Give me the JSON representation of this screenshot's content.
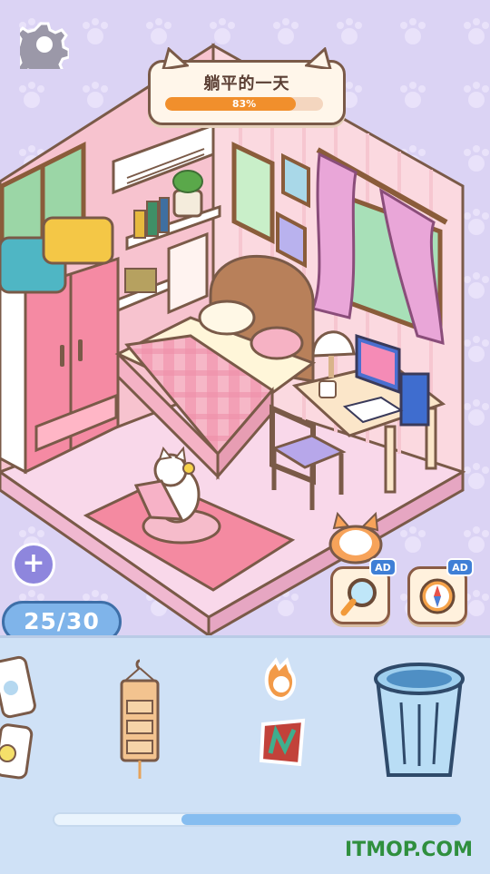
{
  "level": {
    "title": "躺平的一天",
    "progress_percent": 83,
    "progress_label": "83%"
  },
  "inventory": {
    "count_label": "25/30",
    "add_icon": "plus-icon",
    "items": [
      "sticker-cards",
      "hanging-organizer",
      "animal-stickers",
      "trash-bin"
    ]
  },
  "tools": {
    "search_badge": "AD",
    "compass_badge": "AD"
  },
  "watermark": "ITMOP.COM",
  "colors": {
    "accent_orange": "#f18f2c",
    "counter_blue": "#7fb4ea",
    "panel_blue": "#cfe1f6"
  }
}
